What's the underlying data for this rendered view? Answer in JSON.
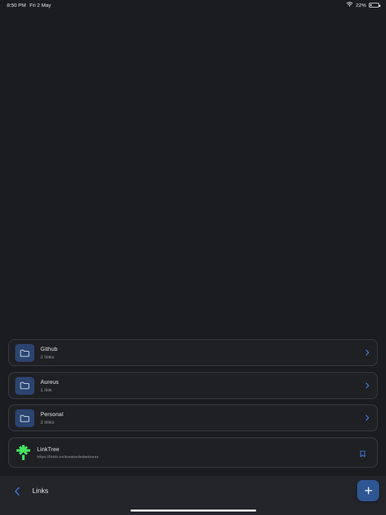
{
  "status_bar": {
    "time": "8:50 PM",
    "date": "Fri 2 May",
    "battery_percent": "22%",
    "battery_level": 0.22
  },
  "folders": [
    {
      "title": "Github",
      "subtitle": "2 links",
      "icon": "folder-icon"
    },
    {
      "title": "Aureus",
      "subtitle": "1 link",
      "icon": "folder-icon"
    },
    {
      "title": "Personal",
      "subtitle": "2 links",
      "icon": "folder-icon"
    }
  ],
  "link_item": {
    "title": "LinkTree",
    "url": "https://linktr.ee/kreatordedarkness",
    "icon": "linktree-logo-icon",
    "action_icon": "bookmark-icon"
  },
  "bottom_bar": {
    "title": "Links",
    "back_icon": "chevron-left-icon",
    "add_icon": "plus-icon"
  },
  "colors": {
    "background": "#1b1c20",
    "accent": "#3d7ee0",
    "folder_tile": "#2b4470",
    "fab": "#2e5694",
    "linktree_green": "#43e660"
  }
}
